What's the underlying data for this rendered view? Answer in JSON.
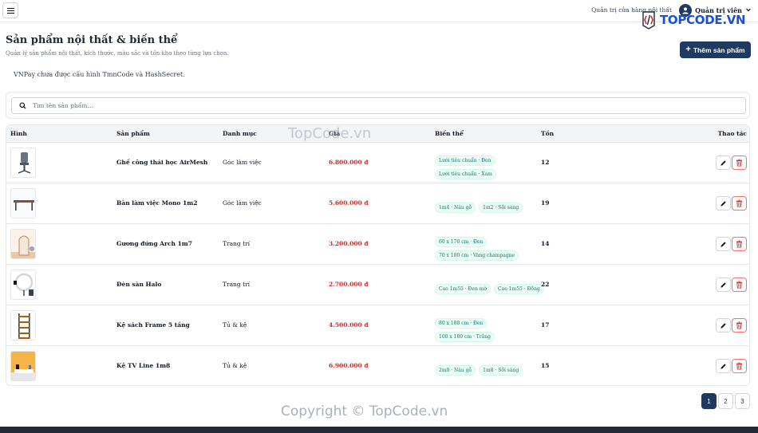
{
  "topbar": {
    "nav_text": "Quản trị cửa hàng nội thất",
    "user_name": "Quản trị viên"
  },
  "watermark": {
    "logo_text": "TOPCODE.VN",
    "mid_text": "TopCode.vn",
    "copyright": "Copyright © TopCode.vn"
  },
  "header": {
    "title": "Sản phẩm nội thất & biến thể",
    "subtitle": "Quản lý sản phẩm nội thất, kích thước, màu sắc và tồn kho theo từng lựa chọn.",
    "add_button": "Thêm sản phẩm"
  },
  "alert": "VNPay chưa được cấu hình TmnCode và HashSecret.",
  "search": {
    "placeholder": "Tìm tên sản phẩm..."
  },
  "table": {
    "columns": [
      "Hình",
      "Sản phẩm",
      "Danh mục",
      "Giá",
      "Biến thể",
      "Tồn",
      "Thao tác"
    ],
    "rows": [
      {
        "name": "Ghế công thái học AirMesh",
        "category": "Góc làm việc",
        "price": "6.800.000 đ",
        "variants": [
          [
            "Lưới tiêu chuẩn · Đen"
          ],
          [
            "Lưới tiêu chuẩn · Xám"
          ]
        ],
        "stock": "12"
      },
      {
        "name": "Bàn làm việc Mono 1m2",
        "category": "Góc làm việc",
        "price": "5.600.000 đ",
        "variants": [
          [
            "1m4 · Nâu gỗ",
            "1m2 · Sồi sáng"
          ]
        ],
        "stock": "19"
      },
      {
        "name": "Gương đứng Arch 1m7",
        "category": "Trang trí",
        "price": "3.200.000 đ",
        "variants": [
          [
            "60 x 170 cm · Đen"
          ],
          [
            "70 x 180 cm · Vàng champagne"
          ]
        ],
        "stock": "14"
      },
      {
        "name": "Đèn sàn Halo",
        "category": "Trang trí",
        "price": "2.700.000 đ",
        "variants": [
          [
            "Cao 1m55 · Đen mờ",
            "Cao 1m55 · Đồng"
          ]
        ],
        "stock": "22"
      },
      {
        "name": "Kệ sách Frame 5 tầng",
        "category": "Tủ & kệ",
        "price": "4.500.000 đ",
        "variants": [
          [
            "80 x 180 cm · Đen"
          ],
          [
            "100 x 180 cm · Trắng"
          ]
        ],
        "stock": "17"
      },
      {
        "name": "Kệ TV Line 1m8",
        "category": "Tủ & kệ",
        "price": "6.900.000 đ",
        "variants": [
          [
            "2m0 · Nâu gỗ",
            "1m8 · Sồi sáng"
          ]
        ],
        "stock": "15"
      }
    ]
  },
  "pagination": {
    "pages": [
      "1",
      "2",
      "3"
    ],
    "current": "1"
  },
  "colors": {
    "primary": "#1e3a5f",
    "price": "#dc2626",
    "chip_text": "#0f766e",
    "danger": "#f87171"
  }
}
